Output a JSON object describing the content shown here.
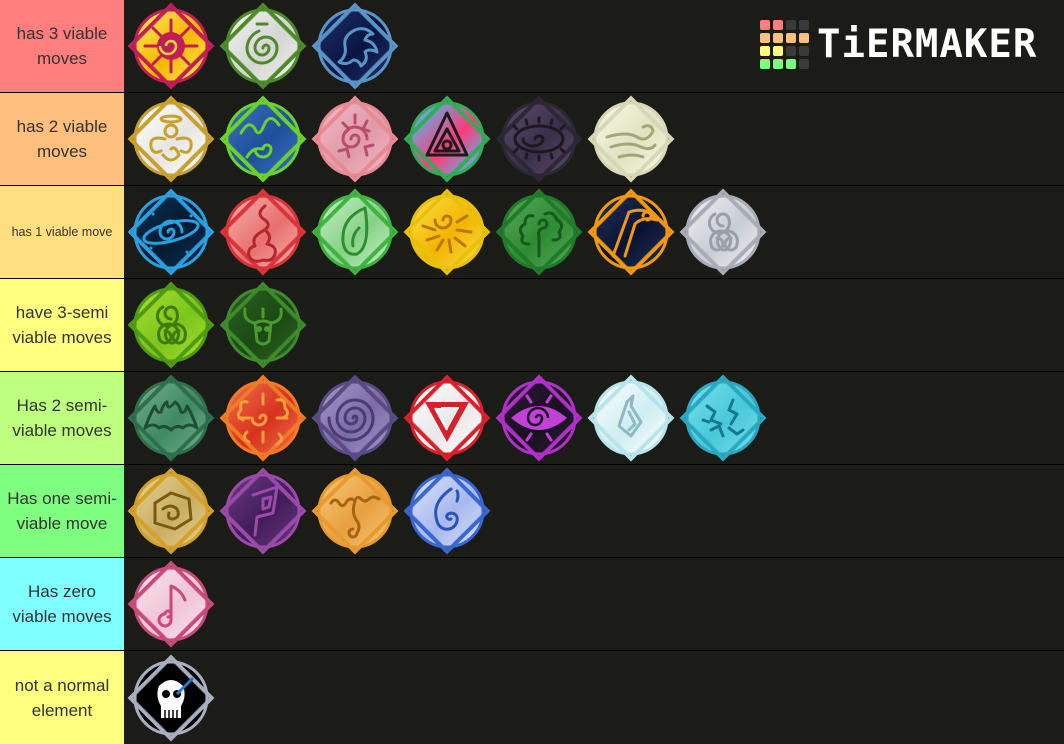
{
  "brand": {
    "name": "TiERMAKER",
    "logo_grid_colors": [
      [
        "#ff7f7f",
        "#ff7f7f",
        "#3a3a3a",
        "#3a3a3a"
      ],
      [
        "#ffbf7f",
        "#ffbf7f",
        "#ffbf7f",
        "#ffbf7f"
      ],
      [
        "#ffff7f",
        "#ffff7f",
        "#3a3a3a",
        "#3a3a3a"
      ],
      [
        "#7fff7f",
        "#7fff7f",
        "#7fff7f",
        "#3a3a3a"
      ]
    ]
  },
  "tiers": [
    {
      "label": "has 3 viable moves",
      "color": "#ff7f7f",
      "items": [
        {
          "name": "sun",
          "rim": "#c21e56",
          "fill": "#f5b800",
          "fill2": "#ffec60",
          "glyph": "sun-spiral",
          "glyph_color": "#c21e56"
        },
        {
          "name": "wind-spiral",
          "rim": "#4e8a2a",
          "fill": "#d5d6d3",
          "fill2": "#f3f3f1",
          "glyph": "spiral",
          "glyph_color": "#4e8a2a"
        },
        {
          "name": "dragon",
          "rim": "#5a94c4",
          "fill": "#0a1440",
          "fill2": "#1d2f6a",
          "glyph": "dragon",
          "glyph_color": "#5a94c4"
        }
      ]
    },
    {
      "label": "has 2 viable moves",
      "color": "#ffbf7f",
      "items": [
        {
          "name": "angel",
          "rim": "#c8a030",
          "fill": "#e6e6e2",
          "fill2": "#ffffff",
          "glyph": "angel",
          "glyph_color": "#c8a030"
        },
        {
          "name": "earth",
          "rim": "#6ad22a",
          "fill": "#1f4f9a",
          "fill2": "#3a70c0",
          "glyph": "planet",
          "glyph_color": "#6ad22a"
        },
        {
          "name": "cracked",
          "rim": "#e88a96",
          "fill": "#e09aa8",
          "fill2": "#f3bac5",
          "glyph": "cracks",
          "glyph_color": "#b84f6a"
        },
        {
          "name": "prism",
          "rim": "#33aa55",
          "fill": "#ff3a7a",
          "fill2": "#2ad4ff",
          "glyph": "triangle-eye",
          "glyph_color": "#1b1b1b"
        },
        {
          "name": "void",
          "rim": "#2d2633",
          "fill": "#3a2f4a",
          "fill2": "#5a4c6a",
          "glyph": "ellipse-spiral",
          "glyph_color": "#1d171f"
        },
        {
          "name": "gust",
          "rim": "#d6d8b8",
          "fill": "#e0e2c0",
          "fill2": "#fafbe6",
          "glyph": "wind",
          "glyph_color": "#a4a67a"
        }
      ]
    },
    {
      "label": "has 1 viable move",
      "color": "#ffdf7f",
      "small": true,
      "items": [
        {
          "name": "space",
          "rim": "#2aa0e0",
          "fill": "#041a30",
          "fill2": "#0b3050",
          "glyph": "galaxy",
          "glyph_color": "#2aa0e0"
        },
        {
          "name": "blood",
          "rim": "#d8343a",
          "fill": "#e8706e",
          "fill2": "#f7b2ae",
          "glyph": "flame-shape",
          "glyph_color": "#b3272e"
        },
        {
          "name": "nature",
          "rim": "#3fb33f",
          "fill": "#86d286",
          "fill2": "#c6efc6",
          "glyph": "leaf",
          "glyph_color": "#2f8f2f"
        },
        {
          "name": "light",
          "rim": "#e8c20a",
          "fill": "#f2b400",
          "fill2": "#ffe04a",
          "glyph": "sun-rays",
          "glyph_color": "#b87800"
        },
        {
          "name": "plant",
          "rim": "#1f7a2a",
          "fill": "#2f8a32",
          "fill2": "#56a85a",
          "glyph": "tree",
          "glyph_color": "#145a1c"
        },
        {
          "name": "scythe",
          "rim": "#f09810",
          "fill": "#0a1230",
          "fill2": "#203058",
          "glyph": "scythe",
          "glyph_color": "#f09810"
        },
        {
          "name": "air",
          "rim": "#a8acb4",
          "fill": "#c8ccd4",
          "fill2": "#f1f2f5",
          "glyph": "triskele",
          "glyph_color": "#9aa0aa"
        }
      ]
    },
    {
      "label": "have 3-semi viable moves",
      "color": "#ffff7f",
      "items": [
        {
          "name": "poison",
          "rim": "#4e9a12",
          "fill": "#7cc41c",
          "fill2": "#a6e030",
          "glyph": "triskele",
          "glyph_color": "#3f7a10"
        },
        {
          "name": "bull",
          "rim": "#3f8a2a",
          "fill": "#1a4a14",
          "fill2": "#2a6020",
          "glyph": "bull",
          "glyph_color": "#4a9a30"
        }
      ]
    },
    {
      "label": "Has 2 semi-viable moves",
      "color": "#bfff7f",
      "items": [
        {
          "name": "bat",
          "rim": "#2e6e4e",
          "fill": "#3f8a62",
          "fill2": "#74b08e",
          "glyph": "bat",
          "glyph_color": "#1f4e36"
        },
        {
          "name": "explosion",
          "rim": "#f07a26",
          "fill": "#d8321e",
          "fill2": "#f0704a",
          "glyph": "burst",
          "glyph_color": "#f0a040"
        },
        {
          "name": "hypno",
          "rim": "#5a4a82",
          "fill": "#7a6ca8",
          "fill2": "#a898cc",
          "glyph": "spiral-big",
          "glyph_color": "#4a3c70"
        },
        {
          "name": "paradox",
          "rim": "#d8202a",
          "fill": "#e8e8ea",
          "fill2": "#ffffff",
          "glyph": "impossible-triangle",
          "glyph_color": "#d8202a"
        },
        {
          "name": "mind",
          "rim": "#b030c8",
          "fill": "#1a1020",
          "fill2": "#2a1a34",
          "glyph": "eye",
          "glyph_color": "#c040d8"
        },
        {
          "name": "crystal",
          "rim": "#b8e4ea",
          "fill": "#cfeef2",
          "fill2": "#ffffff",
          "glyph": "crystal",
          "glyph_color": "#8fbac2"
        },
        {
          "name": "storm",
          "rim": "#2aa8c0",
          "fill": "#48c8da",
          "fill2": "#7ae0ea",
          "glyph": "lightning",
          "glyph_color": "#16788c"
        }
      ]
    },
    {
      "label": "Has one semi-viable move",
      "color": "#7fff7f",
      "items": [
        {
          "name": "sand",
          "rim": "#d4a028",
          "fill": "#c8ac60",
          "fill2": "#e8d494",
          "glyph": "hex-spiral",
          "glyph_color": "#7a5a10"
        },
        {
          "name": "shadow",
          "rim": "#9a4aa8",
          "fill": "#401c58",
          "fill2": "#6a3a84",
          "glyph": "rune",
          "glyph_color": "#9a4aa8"
        },
        {
          "name": "magma",
          "rim": "#e89a30",
          "fill": "#e8a040",
          "fill2": "#f8c878",
          "glyph": "drip",
          "glyph_color": "#a86410"
        },
        {
          "name": "water",
          "rim": "#3a66d0",
          "fill": "#a8b8ee",
          "fill2": "#dce4fb",
          "glyph": "droplet",
          "glyph_color": "#2a54b8"
        }
      ]
    },
    {
      "label": "Has zero viable moves",
      "color": "#7fffff",
      "items": [
        {
          "name": "sound",
          "rim": "#c84a7a",
          "fill": "#f0c4d4",
          "fill2": "#fbe6ee",
          "glyph": "note",
          "glyph_color": "#c84a7a"
        }
      ]
    },
    {
      "label": "not a normal element",
      "color": "#ffff7f",
      "items": [
        {
          "name": "skull",
          "rim": "#a8b0c0",
          "fill": "#000000",
          "fill2": "#000000",
          "glyph": "skull",
          "glyph_color": "#ffffff"
        }
      ]
    }
  ]
}
